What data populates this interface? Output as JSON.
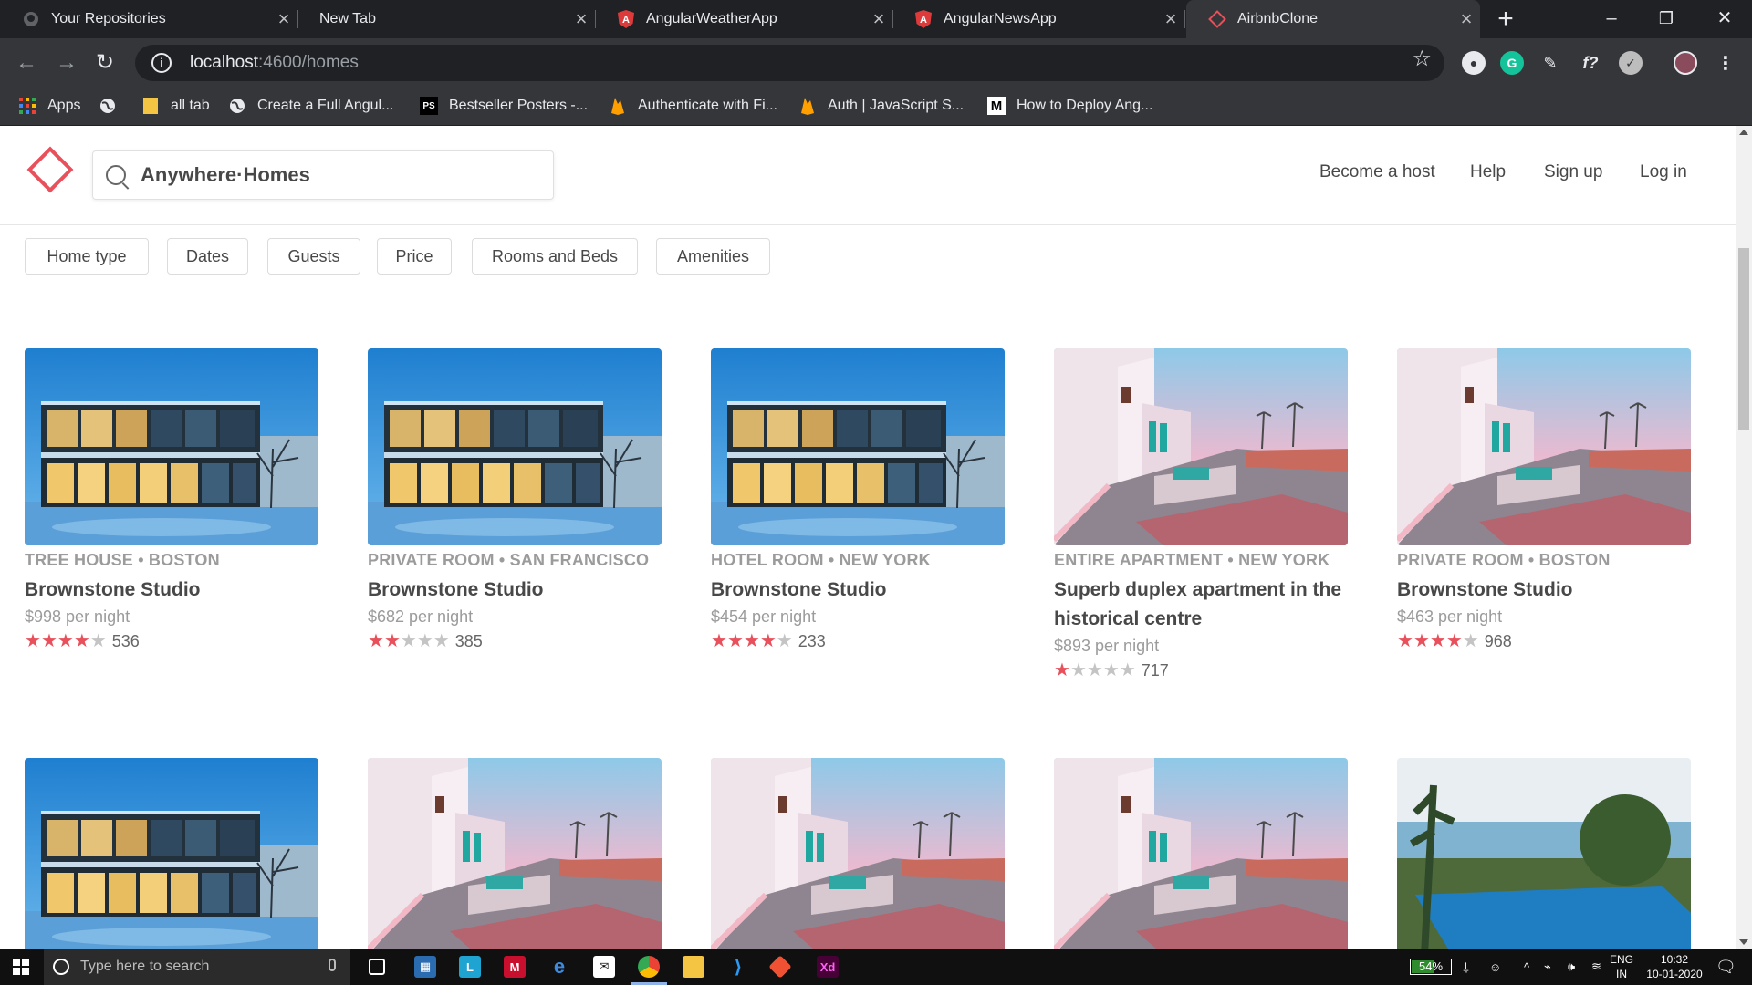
{
  "browser": {
    "tabs": [
      {
        "title": "Your Repositories",
        "icon": "github-icon",
        "active": false
      },
      {
        "title": "New Tab",
        "icon": "",
        "active": false
      },
      {
        "title": "AngularWeatherApp",
        "icon": "angular-icon",
        "active": false
      },
      {
        "title": "AngularNewsApp",
        "icon": "angular-icon",
        "active": false
      },
      {
        "title": "AirbnbClone",
        "icon": "airbnb-clone-icon",
        "active": true
      }
    ],
    "url_host": "localhost",
    "url_path": ":4600/homes",
    "bookmarks": [
      {
        "label": "Apps",
        "icon": "apps-grid-icon"
      },
      {
        "label": "",
        "icon": "globe-icon"
      },
      {
        "label": "all tab",
        "icon": "folder-icon"
      },
      {
        "label": "Create a Full Angul...",
        "icon": "globe-icon"
      },
      {
        "label": "Bestseller Posters -...",
        "icon": "ps-icon"
      },
      {
        "label": "Authenticate with Fi...",
        "icon": "firebase-icon"
      },
      {
        "label": "Auth | JavaScript S...",
        "icon": "firebase-icon"
      },
      {
        "label": "How to Deploy Ang...",
        "icon": "medium-icon"
      }
    ]
  },
  "app": {
    "search_query": "Anywhere·Homes",
    "nav": [
      "Become a host",
      "Help",
      "Sign up",
      "Log in"
    ],
    "filters": [
      "Home type",
      "Dates",
      "Guests",
      "Price",
      "Rooms and Beds",
      "Amenities"
    ],
    "listings": [
      {
        "category": "TREE HOUSE • BOSTON",
        "title": "Brownstone Studio",
        "price": "$998 per night",
        "stars": 4,
        "reviews": "536",
        "photo": "modern-house"
      },
      {
        "category": "PRIVATE ROOM • SAN FRANCISCO",
        "title": "Brownstone Studio",
        "price": "$682 per night",
        "stars": 2,
        "reviews": "385",
        "photo": "modern-house"
      },
      {
        "category": "HOTEL ROOM • NEW YORK",
        "title": "Brownstone Studio",
        "price": "$454 per night",
        "stars": 4,
        "reviews": "233",
        "photo": "modern-house"
      },
      {
        "category": "ENTIRE APARTMENT • NEW YORK",
        "title": "Superb duplex apartment in the historical centre",
        "price": "$893 per night",
        "stars": 1,
        "reviews": "717",
        "photo": "pink-terrace"
      },
      {
        "category": "PRIVATE ROOM • BOSTON",
        "title": "Brownstone Studio",
        "price": "$463 per night",
        "stars": 4,
        "reviews": "968",
        "photo": "pink-terrace"
      },
      {
        "category": "",
        "title": "",
        "price": "",
        "stars": 0,
        "reviews": "",
        "photo": "modern-house"
      },
      {
        "category": "",
        "title": "",
        "price": "",
        "stars": 0,
        "reviews": "",
        "photo": "pink-terrace"
      },
      {
        "category": "",
        "title": "",
        "price": "",
        "stars": 0,
        "reviews": "",
        "photo": "pink-terrace"
      },
      {
        "category": "",
        "title": "",
        "price": "",
        "stars": 0,
        "reviews": "",
        "photo": "pink-terrace"
      },
      {
        "category": "",
        "title": "",
        "price": "",
        "stars": 0,
        "reviews": "",
        "photo": "pool-sea"
      }
    ]
  },
  "taskbar": {
    "search_placeholder": "Type here to search",
    "battery": "54%",
    "lang": "ENG",
    "region": "IN",
    "time": "10:32",
    "date": "10-01-2020"
  },
  "colors": {
    "brand": "#e8505b",
    "chrome_dark": "#202124",
    "chrome_mid": "#35363a"
  }
}
